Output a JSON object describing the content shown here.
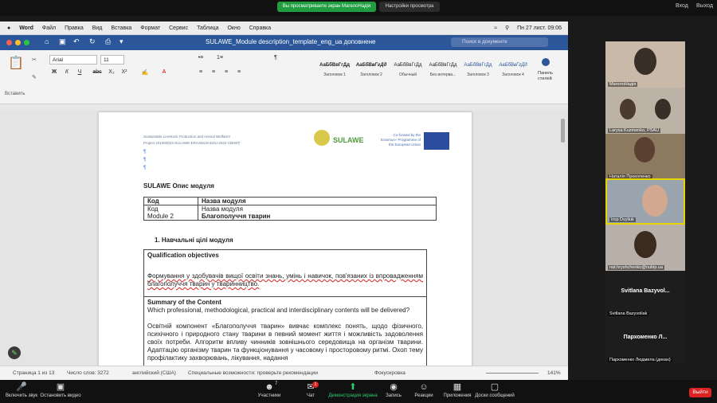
{
  "zoom_top": {
    "share_notice": "Вы просматриваете экран МагелоНадія",
    "view_options": "Настройки просмотра",
    "enter": "Вход",
    "exit": "Выход"
  },
  "mac_menu": {
    "apple": "",
    "app": "Word",
    "items": [
      "Файл",
      "Правка",
      "Вид",
      "Вставка",
      "Формат",
      "Сервис",
      "Таблица",
      "Окно",
      "Справка"
    ],
    "clock": "Пн 27 лист.  09:06"
  },
  "word": {
    "doc_title": "SULAWE_Module description_template_eng_ua доповнене",
    "search_placeholder": "Поиск в документе",
    "paste_label": "Вставить",
    "font": "Arial",
    "size": "11",
    "styles": [
      {
        "sample": "АаБбВвГгДд",
        "label": "Заголовок 1"
      },
      {
        "sample": "АаБбВвГгДд",
        "label": "Заголовок 2"
      },
      {
        "sample": "АаБбВвГгДд",
        "label": "Обычный"
      },
      {
        "sample": "АаБбВвГгДд",
        "label": "Без интерва..."
      },
      {
        "sample": "АаБбВвГгДд",
        "label": "Заголовок 3"
      },
      {
        "sample": "АаБбВвГгДд",
        "label": "Заголовок 4"
      }
    ],
    "styles_pane": "Панель стилей"
  },
  "doc": {
    "hdr1": "Sustainable Livestock Production and Animal Welfare¤",
    "hdr2": "Project 101083023-SULAWE-ERASMUS-EDU-2022-CBHE¶",
    "logo_text": "SULAWE",
    "eu_text": "Co-funded by the Erasmus+ Programme of the European Union",
    "heading": "SULAWE Опис модуля",
    "t1": {
      "r1a": "Код",
      "r1b": "Назва модуля",
      "r2a": "Код",
      "r2b": "Назва модуля",
      "r3a": "Module 2",
      "r3b": "Благополуччя тварин"
    },
    "sec1": "1.  Навчальні цілі модуля",
    "qo": "Qualification objectives",
    "qo_text": "Формування у здобувачів вищої освіти знань, умінь і навичок, пов'язаних із впровадженням благополуччя тварин у тваринництво.",
    "sc": "Summary of the Content",
    "sc_q": "Which professional, methodological, practical and interdisciplinary contents will be delivered?",
    "sc_text": "Освітній компонент «Благополуччя тварин» вивчає комплекс понять, щодо фізичного, психічного і природного стану тварини в певний момент життя і можливість задоволення своїх потреби. Алгоритм впливу чинників зовнішнього середовища на організм тварини. Адаптацію організму тварин та функціонування у часовому і просторовому ритмі. Охоп тему профілактику захворювань, лікування, надання"
  },
  "status": {
    "page": "Страница 1 из 13",
    "words": "Число слов: 3272",
    "lang": "английский (США)",
    "access": "Специальные возможности: проверьте рекомендации",
    "focus": "Фокусировка",
    "zoom": "141%"
  },
  "participants": [
    {
      "name": "МагелоНадія"
    },
    {
      "name": "Larysa Kuzmenko, PSAU"
    },
    {
      "name": "Наталія Прокопенко"
    },
    {
      "name": "Ігор Dvyliuk"
    },
    {
      "name": "nat.hryshchenko@nubip.ua"
    },
    {
      "name": "Svitlana Bazyvol...",
      "sub": "Svitlana Bazyvoliak"
    },
    {
      "name": "Пархоменко Л...",
      "sub": "Пархоменко Людмила (декан)"
    }
  ],
  "zoom_bottom": {
    "mute": "Включить звук",
    "video": "Остановить видео",
    "participants": "Участники",
    "participants_count": "7",
    "chat": "Чат",
    "chat_badge": "1",
    "share": "Демонстрация экрана",
    "record": "Запись",
    "reactions": "Реакции",
    "apps": "Приложения",
    "whiteboard": "Доски сообщений",
    "leave": "Выйти"
  },
  "colors": {
    "word_blue": "#2b579a",
    "share_green": "#1f9d3f",
    "leave_red": "#dd2222",
    "active_border": "#e5d400"
  }
}
